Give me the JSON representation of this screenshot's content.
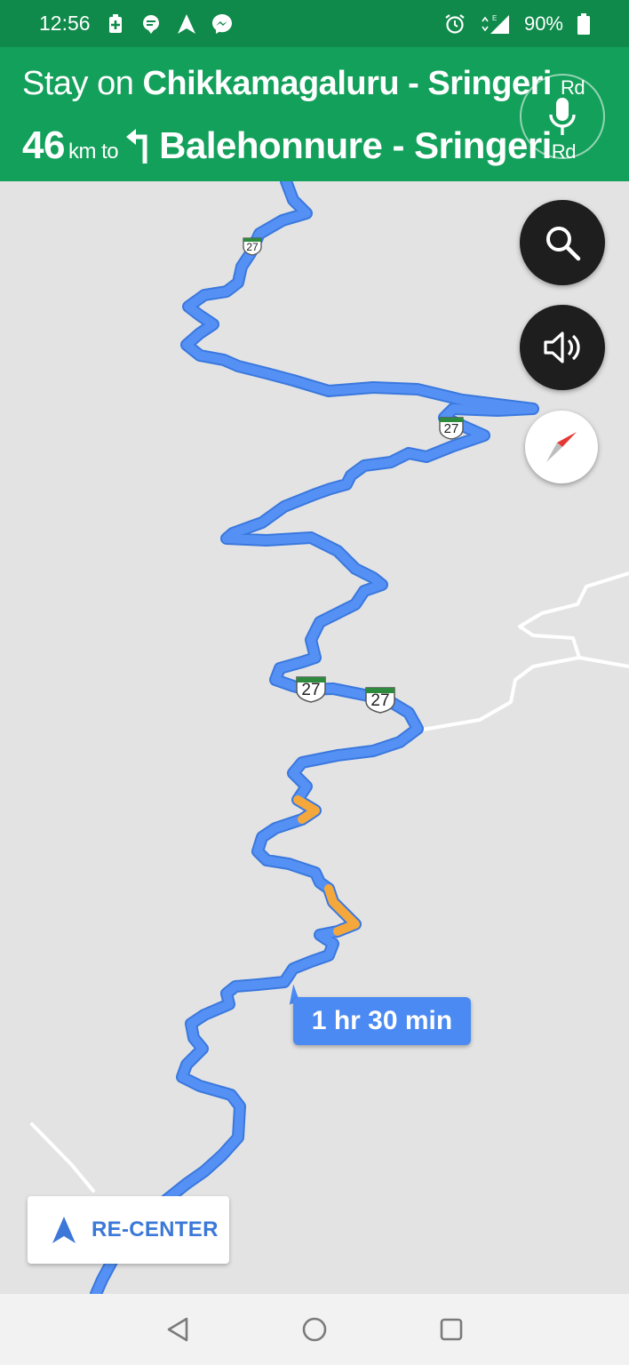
{
  "status_bar": {
    "time": "12:56",
    "battery": "90%",
    "left_icons": [
      "battery-saver-icon",
      "chat-bubble-icon",
      "navigation-arrow-icon",
      "messenger-icon"
    ],
    "right_icons": [
      "alarm-icon",
      "signal-icon",
      "battery-icon"
    ]
  },
  "banner": {
    "stay_on": "Stay on",
    "current_road": "Chikkamagaluru - Sringeri",
    "current_road_suffix": "Rd",
    "distance": "46",
    "distance_unit": "km to",
    "next_road": "Balehonnure - Sringeri",
    "next_road_suffix": "Rd",
    "turn_icon": "turn-left-arrow-icon",
    "color": "#12a05a"
  },
  "map": {
    "route_number": "27",
    "route_color": "#4a8af2",
    "traffic_color": "#f4a73b",
    "eta": "1 hr 30 min"
  },
  "controls": {
    "search_icon": "search-icon",
    "sound_icon": "volume-icon",
    "compass_icon": "compass-icon",
    "mic_icon": "microphone-icon",
    "recenter_label": "RE-CENTER"
  },
  "system_nav": [
    "back-icon",
    "home-icon",
    "recents-icon"
  ]
}
